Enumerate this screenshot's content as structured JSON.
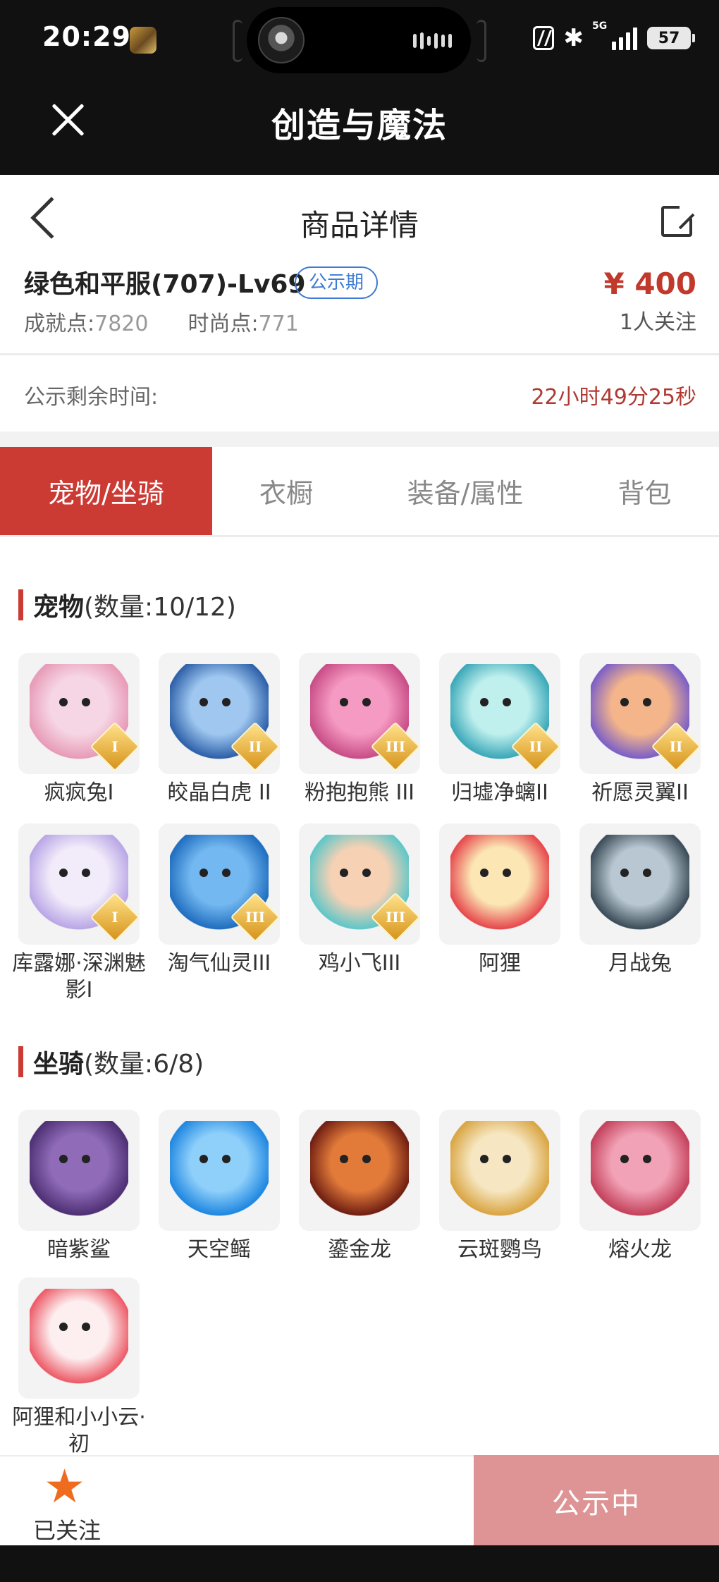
{
  "status_bar": {
    "time": "20:29",
    "network": "5G",
    "battery": "57"
  },
  "titlebar": {
    "title": "创造与魔法"
  },
  "page": {
    "title": "商品详情"
  },
  "product": {
    "name": "绿色和平服(707)-Lv69",
    "tag": "公示期",
    "achievement_label": "成就点:",
    "achievement_value": "7820",
    "fashion_label": "时尚点:",
    "fashion_value": "771",
    "price": "¥ 400",
    "followers": "1人关注"
  },
  "timer": {
    "label": "公示剩余时间:",
    "value": "22小时49分25秒"
  },
  "tabs": [
    {
      "label": "宠物/坐骑",
      "active": true
    },
    {
      "label": "衣橱",
      "active": false
    },
    {
      "label": "装备/属性",
      "active": false
    },
    {
      "label": "背包",
      "active": false
    }
  ],
  "pets": {
    "title": "宠物",
    "count": "(数量:10/12)",
    "items": [
      {
        "name": "疯疯兔I",
        "rank": "I",
        "colors": [
          "#f6d6e4",
          "#e79ab7"
        ]
      },
      {
        "name": "皎晶白虎 II",
        "rank": "II",
        "colors": [
          "#9fc7f0",
          "#2c5fa8"
        ]
      },
      {
        "name": "粉抱抱熊 III",
        "rank": "III",
        "colors": [
          "#f59ac2",
          "#c84c86"
        ]
      },
      {
        "name": "归墟净螭II",
        "rank": "II",
        "colors": [
          "#bff0ee",
          "#3aa7b8"
        ]
      },
      {
        "name": "祈愿灵翼II",
        "rank": "II",
        "colors": [
          "#f4b58a",
          "#7a5ec8"
        ]
      },
      {
        "name": "库露娜·深渊魅影I",
        "rank": "I",
        "colors": [
          "#f2ecfa",
          "#b9a6e6"
        ]
      },
      {
        "name": "淘气仙灵III",
        "rank": "III",
        "colors": [
          "#73b8f0",
          "#1f6dbf"
        ]
      },
      {
        "name": "鸡小飞III",
        "rank": "III",
        "colors": [
          "#f7d1b4",
          "#5ec6c8"
        ]
      },
      {
        "name": "阿狸",
        "rank": "",
        "colors": [
          "#fbe6b4",
          "#e6474c"
        ]
      },
      {
        "name": "月战兔",
        "rank": "",
        "colors": [
          "#b8c7d1",
          "#3a4b57"
        ]
      }
    ]
  },
  "mounts": {
    "title": "坐骑",
    "count": "(数量:6/8)",
    "items": [
      {
        "name": "暗紫鲨",
        "colors": [
          "#8f6bb8",
          "#4d2f73"
        ]
      },
      {
        "name": "天空鳐",
        "colors": [
          "#8fd0fb",
          "#1e86e0"
        ]
      },
      {
        "name": "鎏金龙",
        "colors": [
          "#e27b3a",
          "#6e1d12"
        ]
      },
      {
        "name": "云斑鹦鸟",
        "colors": [
          "#f6e7c2",
          "#d9a441"
        ]
      },
      {
        "name": "熔火龙",
        "colors": [
          "#f2a2b6",
          "#c3405a"
        ]
      },
      {
        "name": "阿狸和小小云·初",
        "colors": [
          "#fdeef0",
          "#ec5a66"
        ]
      }
    ]
  },
  "bottom": {
    "follow_label": "已关注",
    "cta_label": "公示中",
    "star_color": "#ef6c1e"
  },
  "colors": {
    "accent": "#cc3a34",
    "price": "#c0392b",
    "tag": "#3e7bd4",
    "cta_disabled": "#de9494"
  }
}
